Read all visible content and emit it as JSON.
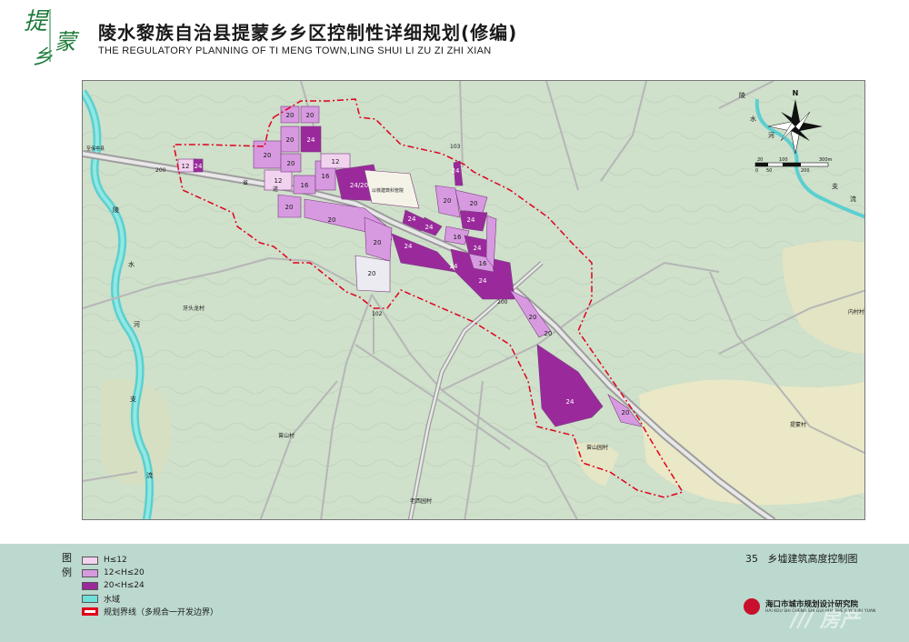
{
  "header": {
    "logo_text": "提蒙乡",
    "title_cn": "陵水黎族自治县提蒙乡乡区控制性详细规划(修编)",
    "title_en": "THE  REGULATORY PLANNING OF TI MENG TOWN,LING SHUI LI ZU ZI ZHI XIAN"
  },
  "map": {
    "colors": {
      "bg": "#cfe0cb",
      "low": "#f1d2ef",
      "mid": "#d79ae0",
      "high": "#9a2a9c",
      "water": "#6fe0d8",
      "boundary": "#e0001b",
      "road": "#b9b9b9",
      "sand": "#eae8c6"
    },
    "block_labels": [
      "20",
      "20",
      "24",
      "20",
      "20",
      "12",
      "20",
      "16",
      "16",
      "12",
      "12",
      "24",
      "24/20",
      "20",
      "20",
      "20",
      "24",
      "24",
      "20",
      "24",
      "24",
      "20",
      "24",
      "16",
      "24",
      "24",
      "16",
      "24",
      "20",
      "20",
      "20",
      "24",
      "20"
    ],
    "place_labels": {
      "river_1": "陵",
      "river_2": "水",
      "river_3": "河",
      "river_4": "支",
      "river_5": "流",
      "east_1": "陵",
      "east_2": "水",
      "east_3": "河",
      "east_4": "支",
      "east_5": "流",
      "village_1": "牙头龙村",
      "village_2": "曾山村",
      "village_3": "老西园村",
      "village_4": "曾山园村",
      "village_5": "提蒙村",
      "village_6": "内村村",
      "road_200a": "200",
      "road_200b": "200",
      "road_hwy": "省",
      "road_hwy2": "道",
      "road_103": "103",
      "road_102": "102",
      "school": "以核建筑科管院",
      "west_road": "至保亭县"
    },
    "compass": {
      "north": "N",
      "scale_top": [
        "20",
        "100",
        "300m"
      ],
      "scale_bottom": [
        "0",
        "50",
        "200"
      ]
    }
  },
  "legend": {
    "heading": "图例",
    "items": [
      {
        "label": "H≤12",
        "color": "#f1d2ef"
      },
      {
        "label": "12<H≤20",
        "color": "#d79ae0"
      },
      {
        "label": "20<H≤24",
        "color": "#9a2a9c"
      },
      {
        "label": "水域",
        "color": "#6fe0d8"
      },
      {
        "label": "规划界线（多规合一开发边界）",
        "color": "boundary"
      }
    ]
  },
  "sheet": {
    "number": "35",
    "name": "乡墟建筑高度控制图"
  },
  "institute": {
    "name": "海口市城市规划设计研究院",
    "name_en": "HAI KOU SHI CHENG SHI GUI HUA SHE JI YAN JIU YUAN"
  },
  "watermark": "/// 房产"
}
